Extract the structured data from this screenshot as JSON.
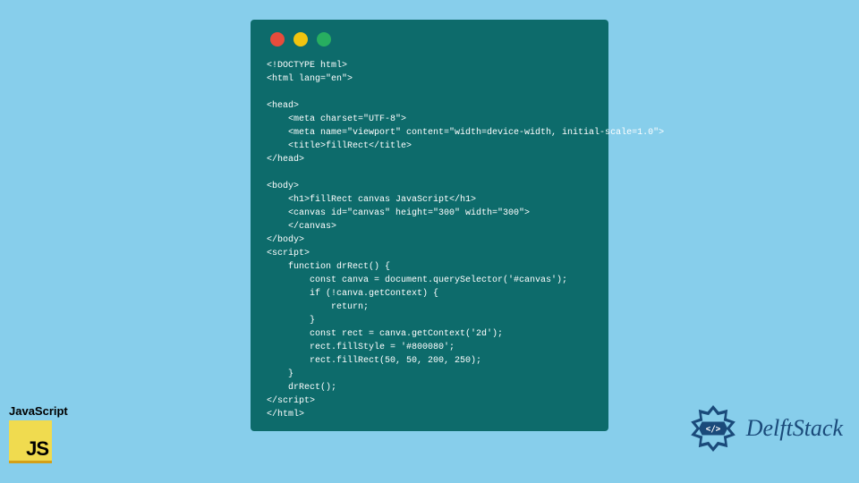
{
  "codeWindow": {
    "trafficLights": [
      "red",
      "yellow",
      "green"
    ],
    "code": "<!DOCTYPE html>\n<html lang=\"en\">\n\n<head>\n    <meta charset=\"UTF-8\">\n    <meta name=\"viewport\" content=\"width=device-width, initial-scale=1.0\">\n    <title>fillRect</title>\n</head>\n\n<body>\n    <h1>fillRect canvas JavaScript</h1>\n    <canvas id=\"canvas\" height=\"300\" width=\"300\">\n    </canvas>\n</body>\n<script>\n    function drRect() {\n        const canva = document.querySelector('#canvas');\n        if (!canva.getContext) {\n            return;\n        }\n        const rect = canva.getContext('2d');\n        rect.fillStyle = '#800080';\n        rect.fillRect(50, 50, 200, 250);\n    }\n    drRect();\n</script>\n</html>"
  },
  "jsBadge": {
    "label": "JavaScript",
    "logoText": "JS"
  },
  "delftBrand": {
    "name": "DelftStack"
  }
}
